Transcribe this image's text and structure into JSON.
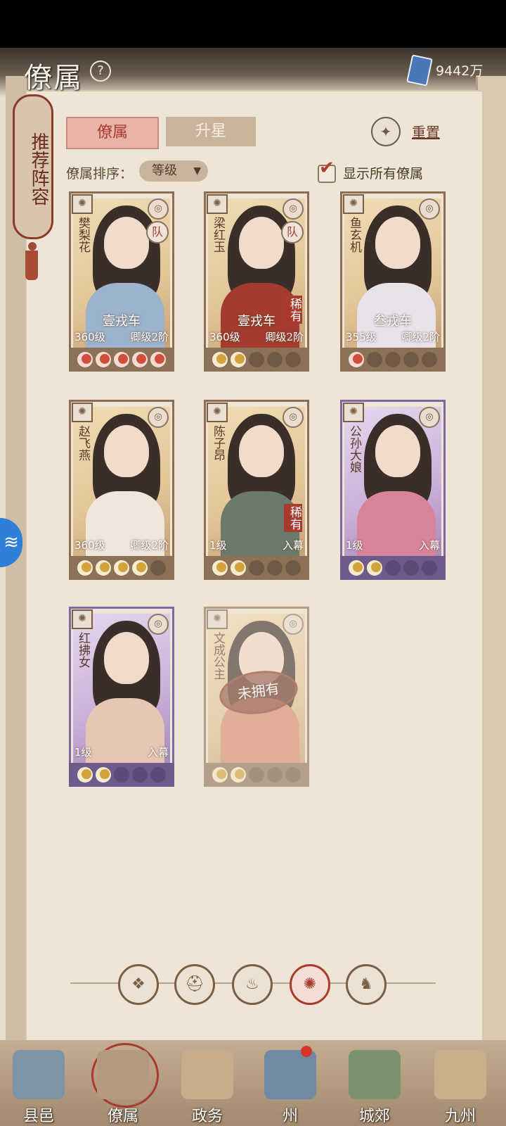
{
  "header": {
    "title": "僚属",
    "currency": "9442万"
  },
  "recommend_scroll": "推荐阵容",
  "tabs": [
    {
      "label": "僚属"
    },
    {
      "label": "升星"
    }
  ],
  "reset": {
    "label": "重置"
  },
  "sort": {
    "label": "僚属排序：",
    "value": "等级"
  },
  "show_all": {
    "label": "显示所有僚属",
    "checked": true
  },
  "cards": [
    {
      "name": "樊梨花",
      "weapon": "壹戎车",
      "level": "360级",
      "rank": "卿级2阶",
      "tier": "gold",
      "team": "队",
      "rare": "",
      "stars": [
        "red",
        "red",
        "red",
        "red",
        "red"
      ],
      "owned": true
    },
    {
      "name": "梁红玉",
      "weapon": "壹戎车",
      "level": "360级",
      "rank": "卿级2阶",
      "tier": "gold",
      "team": "队",
      "rare": "稀有",
      "stars": [
        "gold",
        "gold",
        "empty",
        "empty",
        "empty"
      ],
      "owned": true
    },
    {
      "name": "鱼玄机",
      "weapon": "叁戎车",
      "level": "355级",
      "rank": "卿级2阶",
      "tier": "gold",
      "team": "",
      "rare": "",
      "stars": [
        "red",
        "empty",
        "empty",
        "empty",
        "empty"
      ],
      "owned": true
    },
    {
      "name": "赵飞燕",
      "weapon": "",
      "level": "360级",
      "rank": "卿级2阶",
      "tier": "gold",
      "team": "",
      "rare": "",
      "stars": [
        "gold",
        "gold",
        "gold",
        "gold",
        "empty"
      ],
      "owned": true
    },
    {
      "name": "陈子昂",
      "weapon": "",
      "level": "1级",
      "rank": "入幕",
      "tier": "gold",
      "team": "",
      "rare": "稀有",
      "stars": [
        "gold",
        "gold",
        "empty",
        "empty",
        "empty"
      ],
      "owned": true
    },
    {
      "name": "公孙大娘",
      "weapon": "",
      "level": "1级",
      "rank": "入幕",
      "tier": "purple",
      "team": "",
      "rare": "",
      "stars": [
        "gold",
        "gold",
        "empty",
        "empty",
        "empty"
      ],
      "owned": true
    },
    {
      "name": "红拂女",
      "weapon": "",
      "level": "1级",
      "rank": "入幕",
      "tier": "purple",
      "team": "",
      "rare": "",
      "stars": [
        "gold",
        "gold",
        "empty",
        "empty",
        "empty"
      ],
      "owned": true
    },
    {
      "name": "文成公主",
      "weapon": "",
      "level": "",
      "rank": "",
      "tier": "gold",
      "team": "",
      "rare": "",
      "stars": [
        "gold",
        "gold",
        "empty",
        "empty",
        "empty"
      ],
      "owned": false,
      "stamp": "未拥有"
    }
  ],
  "nav": [
    {
      "label": "县邑"
    },
    {
      "label": "僚属"
    },
    {
      "label": "政务"
    },
    {
      "label": "州"
    },
    {
      "label": "城郊"
    },
    {
      "label": "九州"
    }
  ],
  "colors": {
    "accent_red": "#a83a2e",
    "paper": "#efe5d6",
    "gold_card": "#e2c698",
    "purple_card": "#c9b0d8"
  }
}
